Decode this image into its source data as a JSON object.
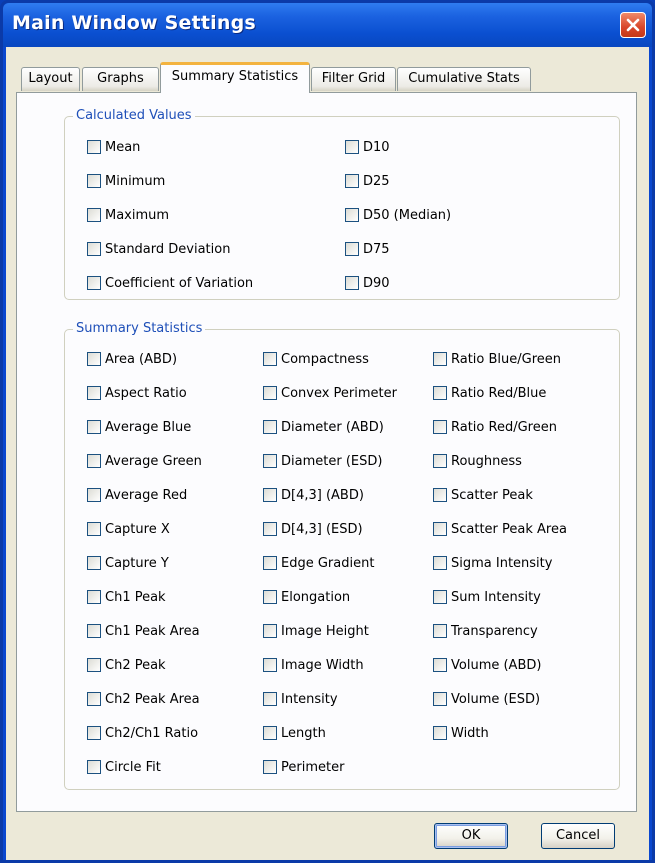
{
  "window": {
    "title": "Main Window Settings"
  },
  "tabs": [
    {
      "label": "Layout",
      "active": false
    },
    {
      "label": "Graphs",
      "active": false
    },
    {
      "label": "Summary Statistics",
      "active": true
    },
    {
      "label": "Filter Grid",
      "active": false
    },
    {
      "label": "Cumulative Stats",
      "active": false
    }
  ],
  "calculated_values": {
    "title": "Calculated Values",
    "col1": [
      "Mean",
      "Minimum",
      "Maximum",
      "Standard Deviation",
      "Coefficient of Variation"
    ],
    "col2": [
      "D10",
      "D25",
      "D50 (Median)",
      "D75",
      "D90"
    ]
  },
  "summary_statistics": {
    "title": "Summary Statistics",
    "col1": [
      "Area (ABD)",
      "Aspect Ratio",
      "Average Blue",
      "Average Green",
      "Average Red",
      "Capture X",
      "Capture Y",
      "Ch1 Peak",
      "Ch1 Peak Area",
      "Ch2 Peak",
      "Ch2 Peak Area",
      "Ch2/Ch1 Ratio",
      "Circle Fit"
    ],
    "col2": [
      "Compactness",
      "Convex Perimeter",
      "Diameter (ABD)",
      "Diameter (ESD)",
      "D[4,3] (ABD)",
      "D[4,3] (ESD)",
      "Edge Gradient",
      "Elongation",
      "Image Height",
      "Image Width",
      "Intensity",
      "Length",
      "Perimeter"
    ],
    "col3": [
      "Ratio Blue/Green",
      "Ratio Red/Blue",
      "Ratio Red/Green",
      "Roughness",
      "Scatter Peak",
      "Scatter Peak Area",
      "Sigma Intensity",
      "Sum Intensity",
      "Transparency",
      "Volume (ABD)",
      "Volume (ESD)",
      "Width"
    ]
  },
  "buttons": {
    "ok": "OK",
    "cancel": "Cancel"
  },
  "colors": {
    "titlebar": "#0a4fd0",
    "dialog_bg": "#ece9d8",
    "group_title": "#1e4fb8",
    "active_tab_accent": "#f3b33f"
  }
}
